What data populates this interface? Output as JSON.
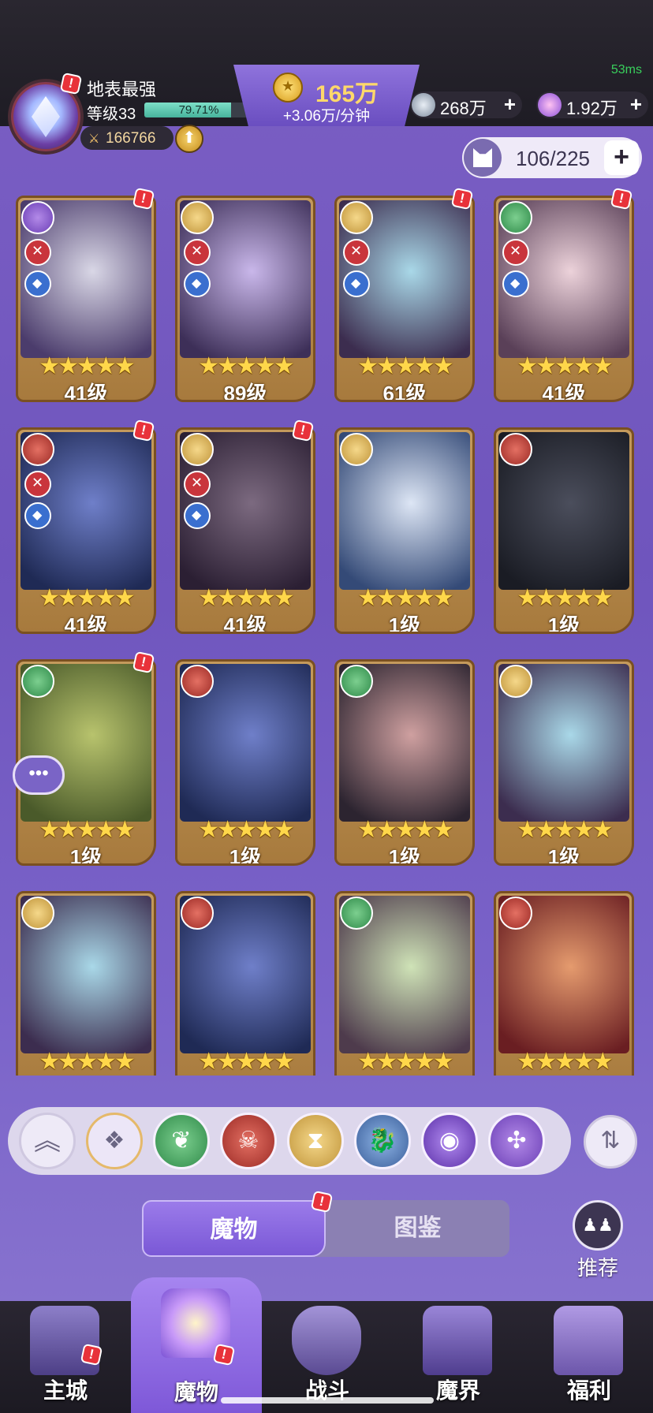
{
  "status": {
    "latency": "53ms"
  },
  "player": {
    "name": "地表最强",
    "level_label": "等级33",
    "xp_percent_label": "79.71%",
    "xp_fraction": 0.7971,
    "power": "166766"
  },
  "currency": {
    "gold": "165万",
    "gold_rate": "+3.06万/分钟",
    "silver": "268万",
    "crystal": "1.92万"
  },
  "capacity": {
    "text": "106/225"
  },
  "cards": [
    {
      "level": "41级",
      "faction": "wind",
      "stars": "★★★★★",
      "alert": true,
      "badges": true
    },
    {
      "level": "89级",
      "faction": "sand",
      "stars": "★★★★★",
      "alert": false,
      "badges": true
    },
    {
      "level": "61级",
      "faction": "sand",
      "stars": "★★★★★",
      "alert": true,
      "badges": true
    },
    {
      "level": "41级",
      "faction": "leaf",
      "stars": "★★★★★",
      "alert": true,
      "badges": true
    },
    {
      "level": "41级",
      "faction": "skull",
      "stars": "★★★★★",
      "alert": true,
      "badges": true
    },
    {
      "level": "41级",
      "faction": "sand",
      "stars": "★★★★★",
      "alert": true,
      "badges": true
    },
    {
      "level": "1级",
      "faction": "sand",
      "stars": "★★★★★",
      "alert": false,
      "badges": false
    },
    {
      "level": "1级",
      "faction": "skull",
      "stars": "★★★★★",
      "alert": false,
      "badges": false
    },
    {
      "level": "1级",
      "faction": "leaf",
      "stars": "★★★★★",
      "alert": true,
      "badges": false
    },
    {
      "level": "1级",
      "faction": "skull",
      "stars": "★★★★★",
      "alert": false,
      "badges": false
    },
    {
      "level": "1级",
      "faction": "leaf",
      "stars": "★★★★★",
      "alert": false,
      "badges": false
    },
    {
      "level": "1级",
      "faction": "sand",
      "stars": "★★★★★",
      "alert": false,
      "badges": false
    },
    {
      "level": "",
      "faction": "sand",
      "stars": "★★★★★",
      "alert": false,
      "badges": false
    },
    {
      "level": "",
      "faction": "skull",
      "stars": "★★★★★",
      "alert": false,
      "badges": false
    },
    {
      "level": "",
      "faction": "leaf",
      "stars": "★★★★★",
      "alert": false,
      "badges": false
    },
    {
      "level": "",
      "faction": "skull",
      "stars": "★★★★★",
      "alert": false,
      "badges": false
    }
  ],
  "filters": [
    {
      "name": "collapse",
      "icon": "double-chevron-up-icon"
    },
    {
      "name": "all",
      "icon": "diamond-grid-icon"
    },
    {
      "name": "leaf",
      "icon": "leaf-icon"
    },
    {
      "name": "skull",
      "icon": "skull-mask-icon"
    },
    {
      "name": "sand",
      "icon": "hourglass-icon"
    },
    {
      "name": "dragon",
      "icon": "dragon-icon"
    },
    {
      "name": "eye",
      "icon": "eye-icon"
    },
    {
      "name": "wind",
      "icon": "wind-swirl-icon"
    }
  ],
  "tabs": {
    "monster": "魔物",
    "codex": "图鉴"
  },
  "recommend": "推荐",
  "nav": [
    {
      "label": "主城",
      "icon": "castle-icon"
    },
    {
      "label": "魔物",
      "icon": "flame-star-icon"
    },
    {
      "label": "战斗",
      "icon": "sword-shield-icon"
    },
    {
      "label": "魔界",
      "icon": "demon-gate-icon"
    },
    {
      "label": "福利",
      "icon": "treasure-chest-icon"
    }
  ],
  "colors": {
    "accent": "#7a58d6",
    "gold_text": "#ffd86a",
    "alert": "#e8323a",
    "card_bg": "#b8894a"
  }
}
